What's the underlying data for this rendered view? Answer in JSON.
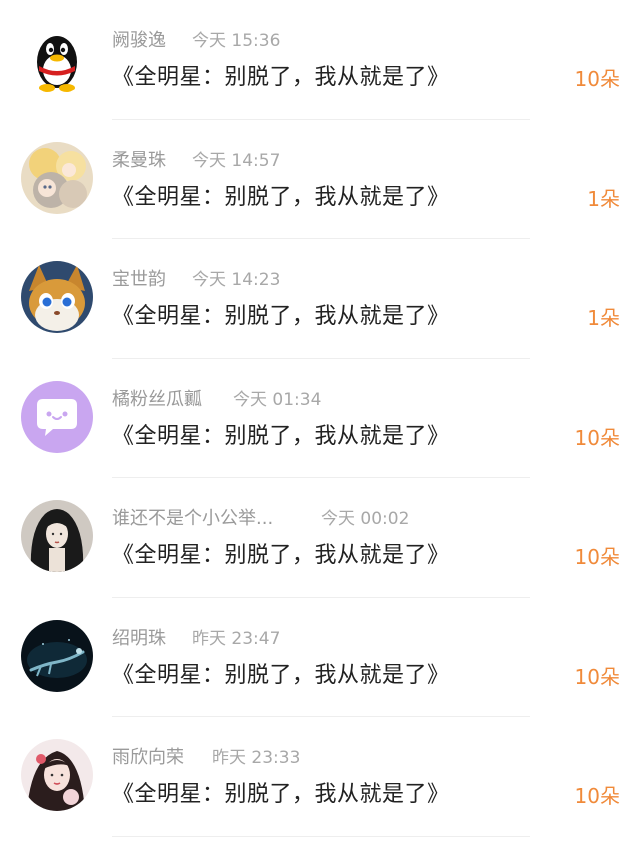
{
  "messages": [
    {
      "name": "阙骏逸",
      "time": "今天 15:36",
      "title": "《全明星：别脱了，我从就是了》",
      "count": "10朵",
      "avatar": "qq-penguin-avatar"
    },
    {
      "name": "柔曼珠",
      "time": "今天 14:57",
      "title": "《全明星：别脱了，我从就是了》",
      "count": "1朵",
      "avatar": "anime-girls-avatar"
    },
    {
      "name": "宝世韵",
      "time": "今天 14:23",
      "title": "《全明星：别脱了，我从就是了》",
      "count": "1朵",
      "avatar": "cartoon-animal-avatar"
    },
    {
      "name": "橘粉丝瓜瓤",
      "time": "今天 01:34",
      "title": "《全明星：别脱了，我从就是了》",
      "count": "10朵",
      "avatar": "chat-bubble-avatar"
    },
    {
      "name": "谁还不是个小公举...",
      "time": "今天 00:02",
      "title": "《全明星：别脱了，我从就是了》",
      "count": "10朵",
      "avatar": "ink-girl-avatar"
    },
    {
      "name": "绍明珠",
      "time": "昨天 23:47",
      "title": "《全明星：别脱了，我从就是了》",
      "count": "10朵",
      "avatar": "underwater-figure-avatar"
    },
    {
      "name": "雨欣向荣",
      "time": "昨天 23:33",
      "title": "《全明星：别脱了，我从就是了》",
      "count": "10朵",
      "avatar": "girl-portrait-avatar"
    }
  ],
  "colors": {
    "count": "#f08a3a",
    "name": "#9a9a9a",
    "title": "#222222",
    "divider": "#eeeeee"
  }
}
